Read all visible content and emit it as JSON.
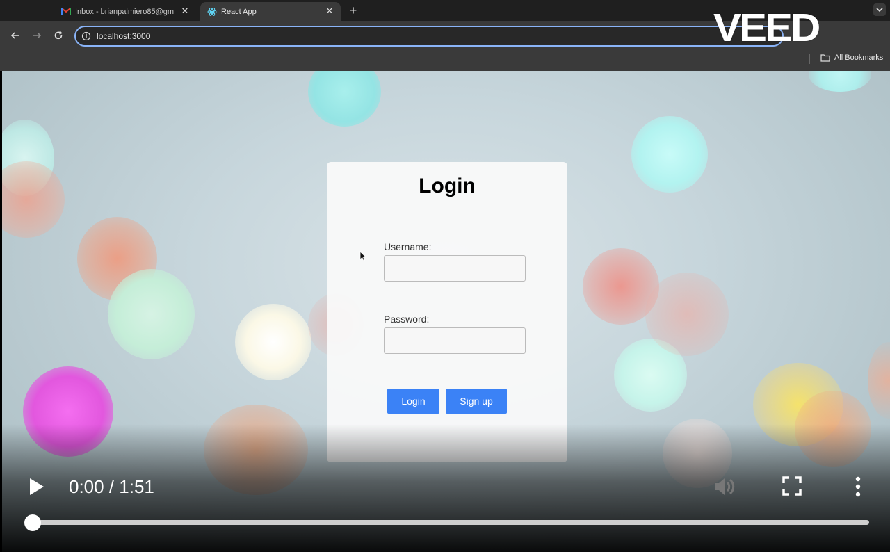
{
  "browser": {
    "tabs": [
      {
        "title": "Inbox - brianpalmiero85@gm",
        "icon": "gmail-icon",
        "active": false
      },
      {
        "title": "React App",
        "icon": "react-icon",
        "active": true
      }
    ],
    "new_tab": "+",
    "url": "localhost:3000",
    "bookmarks_label": "All Bookmarks"
  },
  "watermark": "VEED",
  "login": {
    "title": "Login",
    "username_label": "Username:",
    "username_value": "",
    "password_label": "Password:",
    "password_value": "",
    "login_button": "Login",
    "signup_button": "Sign up"
  },
  "player": {
    "time": "0:00 / 1:51",
    "progress": 0
  },
  "colors": {
    "accent_button": "#3b82f6",
    "omnibox_focus": "#8ab4f8",
    "chrome_dark": "#1f1f1f",
    "chrome_mid": "#3a3a3a"
  }
}
